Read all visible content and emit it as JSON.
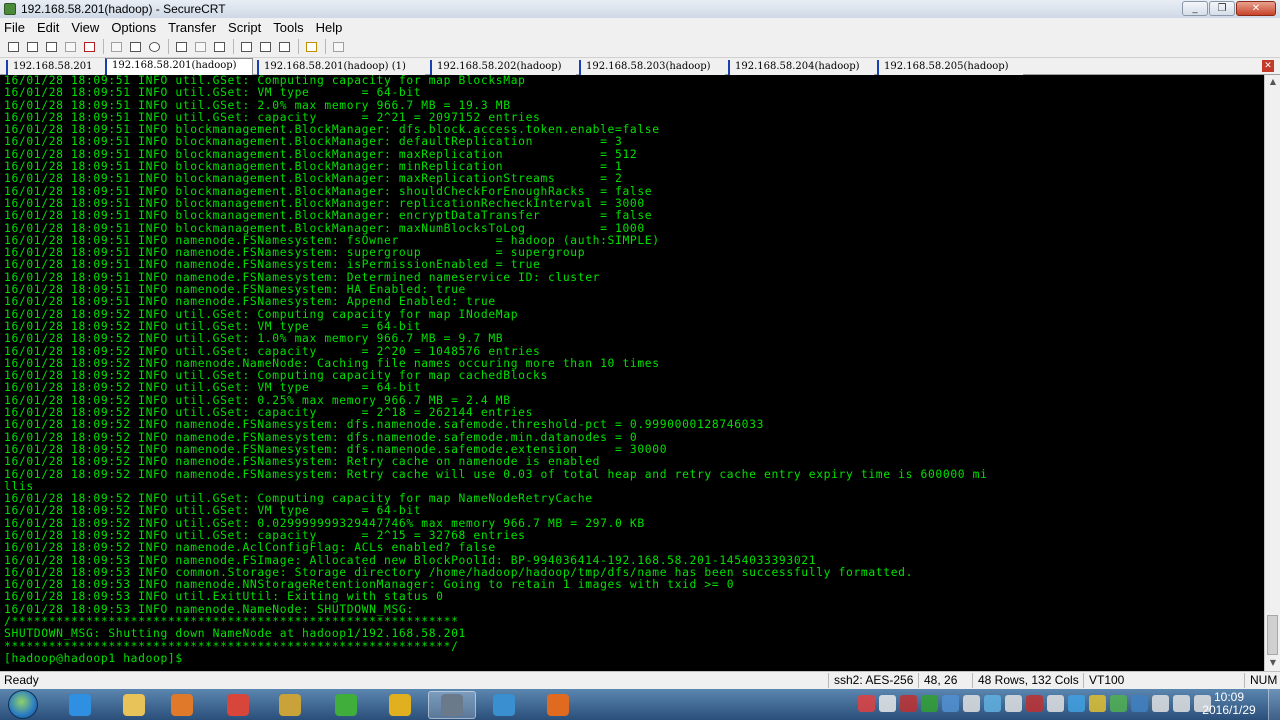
{
  "window": {
    "title": "192.168.58.201(hadoop) - SecureCRT",
    "minimize": "_",
    "maximize": "❐",
    "close": "✕"
  },
  "menu": [
    "File",
    "Edit",
    "View",
    "Options",
    "Transfer",
    "Script",
    "Tools",
    "Help"
  ],
  "toolbar_icons": [
    "connect-icon",
    "quick-connect-icon",
    "connect-tab-icon",
    "reconnect-icon",
    "disconnect-icon",
    "copy-icon",
    "paste-icon",
    "find-icon",
    "print-icon",
    "print-setup-icon",
    "print-screen-icon",
    "session-options-icon",
    "global-options-icon",
    "keymap-icon",
    "help-icon",
    "sftp-icon"
  ],
  "tabs": [
    {
      "label": "192.168.58.201",
      "active": false
    },
    {
      "label": "192.168.58.201(hadoop)",
      "active": true
    },
    {
      "label": "192.168.58.201(hadoop)  (1)",
      "active": false
    },
    {
      "label": "192.168.58.202(hadoop)",
      "active": false
    },
    {
      "label": "192.168.58.203(hadoop)",
      "active": false
    },
    {
      "label": "192.168.58.204(hadoop)",
      "active": false
    },
    {
      "label": "192.168.58.205(hadoop)",
      "active": false
    }
  ],
  "tab_close": "✕",
  "terminal": {
    "color": "#00e000",
    "lines": [
      "16/01/28 18:09:51 INFO util.GSet: Computing capacity for map BlocksMap",
      "16/01/28 18:09:51 INFO util.GSet: VM type       = 64-bit",
      "16/01/28 18:09:51 INFO util.GSet: 2.0% max memory 966.7 MB = 19.3 MB",
      "16/01/28 18:09:51 INFO util.GSet: capacity      = 2^21 = 2097152 entries",
      "16/01/28 18:09:51 INFO blockmanagement.BlockManager: dfs.block.access.token.enable=false",
      "16/01/28 18:09:51 INFO blockmanagement.BlockManager: defaultReplication         = 3",
      "16/01/28 18:09:51 INFO blockmanagement.BlockManager: maxReplication             = 512",
      "16/01/28 18:09:51 INFO blockmanagement.BlockManager: minReplication             = 1",
      "16/01/28 18:09:51 INFO blockmanagement.BlockManager: maxReplicationStreams      = 2",
      "16/01/28 18:09:51 INFO blockmanagement.BlockManager: shouldCheckForEnoughRacks  = false",
      "16/01/28 18:09:51 INFO blockmanagement.BlockManager: replicationRecheckInterval = 3000",
      "16/01/28 18:09:51 INFO blockmanagement.BlockManager: encryptDataTransfer        = false",
      "16/01/28 18:09:51 INFO blockmanagement.BlockManager: maxNumBlocksToLog          = 1000",
      "16/01/28 18:09:51 INFO namenode.FSNamesystem: fsOwner             = hadoop (auth:SIMPLE)",
      "16/01/28 18:09:51 INFO namenode.FSNamesystem: supergroup          = supergroup",
      "16/01/28 18:09:51 INFO namenode.FSNamesystem: isPermissionEnabled = true",
      "16/01/28 18:09:51 INFO namenode.FSNamesystem: Determined nameservice ID: cluster",
      "16/01/28 18:09:51 INFO namenode.FSNamesystem: HA Enabled: true",
      "16/01/28 18:09:51 INFO namenode.FSNamesystem: Append Enabled: true",
      "16/01/28 18:09:52 INFO util.GSet: Computing capacity for map INodeMap",
      "16/01/28 18:09:52 INFO util.GSet: VM type       = 64-bit",
      "16/01/28 18:09:52 INFO util.GSet: 1.0% max memory 966.7 MB = 9.7 MB",
      "16/01/28 18:09:52 INFO util.GSet: capacity      = 2^20 = 1048576 entries",
      "16/01/28 18:09:52 INFO namenode.NameNode: Caching file names occuring more than 10 times",
      "16/01/28 18:09:52 INFO util.GSet: Computing capacity for map cachedBlocks",
      "16/01/28 18:09:52 INFO util.GSet: VM type       = 64-bit",
      "16/01/28 18:09:52 INFO util.GSet: 0.25% max memory 966.7 MB = 2.4 MB",
      "16/01/28 18:09:52 INFO util.GSet: capacity      = 2^18 = 262144 entries",
      "16/01/28 18:09:52 INFO namenode.FSNamesystem: dfs.namenode.safemode.threshold-pct = 0.9990000128746033",
      "16/01/28 18:09:52 INFO namenode.FSNamesystem: dfs.namenode.safemode.min.datanodes = 0",
      "16/01/28 18:09:52 INFO namenode.FSNamesystem: dfs.namenode.safemode.extension     = 30000",
      "16/01/28 18:09:52 INFO namenode.FSNamesystem: Retry cache on namenode is enabled",
      "16/01/28 18:09:52 INFO namenode.FSNamesystem: Retry cache will use 0.03 of total heap and retry cache entry expiry time is 600000 mi",
      "llis",
      "16/01/28 18:09:52 INFO util.GSet: Computing capacity for map NameNodeRetryCache",
      "16/01/28 18:09:52 INFO util.GSet: VM type       = 64-bit",
      "16/01/28 18:09:52 INFO util.GSet: 0.029999999329447746% max memory 966.7 MB = 297.0 KB",
      "16/01/28 18:09:52 INFO util.GSet: capacity      = 2^15 = 32768 entries",
      "16/01/28 18:09:52 INFO namenode.AclConfigFlag: ACLs enabled? false",
      "16/01/28 18:09:53 INFO namenode.FSImage: Allocated new BlockPoolId: BP-994036414-192.168.58.201-1454033393021",
      "16/01/28 18:09:53 INFO common.Storage: Storage directory /home/hadoop/hadoop/tmp/dfs/name has been successfully formatted.",
      "16/01/28 18:09:53 INFO namenode.NNStorageRetentionManager: Going to retain 1 images with txid >= 0",
      "16/01/28 18:09:53 INFO util.ExitUtil: Exiting with status 0",
      "16/01/28 18:09:53 INFO namenode.NameNode: SHUTDOWN_MSG:",
      "/************************************************************",
      "SHUTDOWN_MSG: Shutting down NameNode at hadoop1/192.168.58.201",
      "************************************************************/",
      "[hadoop@hadoop1 hadoop]$ "
    ]
  },
  "scrollbar": {
    "up": "▲",
    "down": "▼"
  },
  "status": {
    "ready": "Ready",
    "encryption": "ssh2: AES-256",
    "cursor": "48,  26",
    "size": "48 Rows, 132 Cols",
    "emulation": "VT100",
    "numlock": "NUM"
  },
  "taskbar": {
    "apps": [
      {
        "name": "internet-explorer-icon",
        "color": "#2f8fe0",
        "active": false
      },
      {
        "name": "file-explorer-icon",
        "color": "#e8c35a",
        "active": false
      },
      {
        "name": "media-player-icon",
        "color": "#e07a2a",
        "active": false
      },
      {
        "name": "chrome-icon",
        "color": "#d8453a",
        "active": false
      },
      {
        "name": "archive-app-icon",
        "color": "#c9a23a",
        "active": false
      },
      {
        "name": "green-refresh-app-icon",
        "color": "#3fae3a",
        "active": false
      },
      {
        "name": "yellow-e-app-icon",
        "color": "#e0b020",
        "active": false
      },
      {
        "name": "securecrt-icon",
        "color": "#6a7a8a",
        "active": true
      },
      {
        "name": "blue-window-app-icon",
        "color": "#3a8fd0",
        "active": false
      },
      {
        "name": "tiger-app-icon",
        "color": "#e06a20",
        "active": false
      }
    ],
    "clock_time": "10:09",
    "clock_date": "2016/1/29"
  }
}
